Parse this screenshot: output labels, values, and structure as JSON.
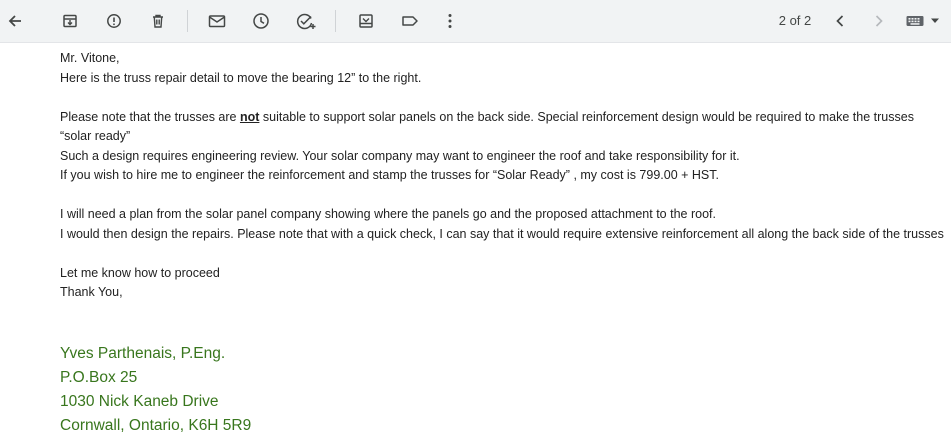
{
  "toolbar": {
    "icons": [
      "back-arrow-icon",
      "archive-icon",
      "report-spam-icon",
      "delete-icon",
      "mark-unread-icon",
      "snooze-icon",
      "add-to-tasks-icon",
      "move-to-icon",
      "label-icon",
      "more-options-icon"
    ],
    "pager_text": "2 of 2",
    "nav_icons": [
      "chevron-left-icon",
      "chevron-right-icon",
      "keyboard-icon",
      "dropdown-arrow-icon"
    ]
  },
  "email": {
    "greeting": "Mr. Vitone,",
    "line1": "Here is the truss repair detail to move the bearing 12” to the right.",
    "para2_pre": "Please note that the trusses are ",
    "para2_bold": "not",
    "para2_post": " suitable to support solar panels on the back side.  Special reinforcement design would be required to make the trusses “solar ready”",
    "line3": "Such a design requires engineering review.  Your solar company may want to engineer the roof and take responsibility for it.",
    "line4": "If you wish to hire me to engineer the reinforcement and stamp the trusses for “Solar Ready” , my cost is 799.00 + HST.",
    "line5": "I will need a plan from the solar panel company showing where the panels go and the proposed attachment to the roof.",
    "line6": "I would then design the repairs.  Please note that with a quick check, I can say that it would require extensive reinforcement all along the back side of the trusses",
    "line7": "Let me know how to proceed",
    "line8": "Thank You,"
  },
  "signature": {
    "name": "Yves Parthenais, P.Eng.",
    "po_box": "P.O.Box 25",
    "street": "1030 Nick Kaneb Drive",
    "city": "Cornwall, Ontario, K6H 5R9"
  },
  "colors": {
    "toolbar_bg": "#f1f3f4",
    "icon": "#444746",
    "icon_disabled": "#b6b9bc",
    "signature": "#38761d"
  }
}
